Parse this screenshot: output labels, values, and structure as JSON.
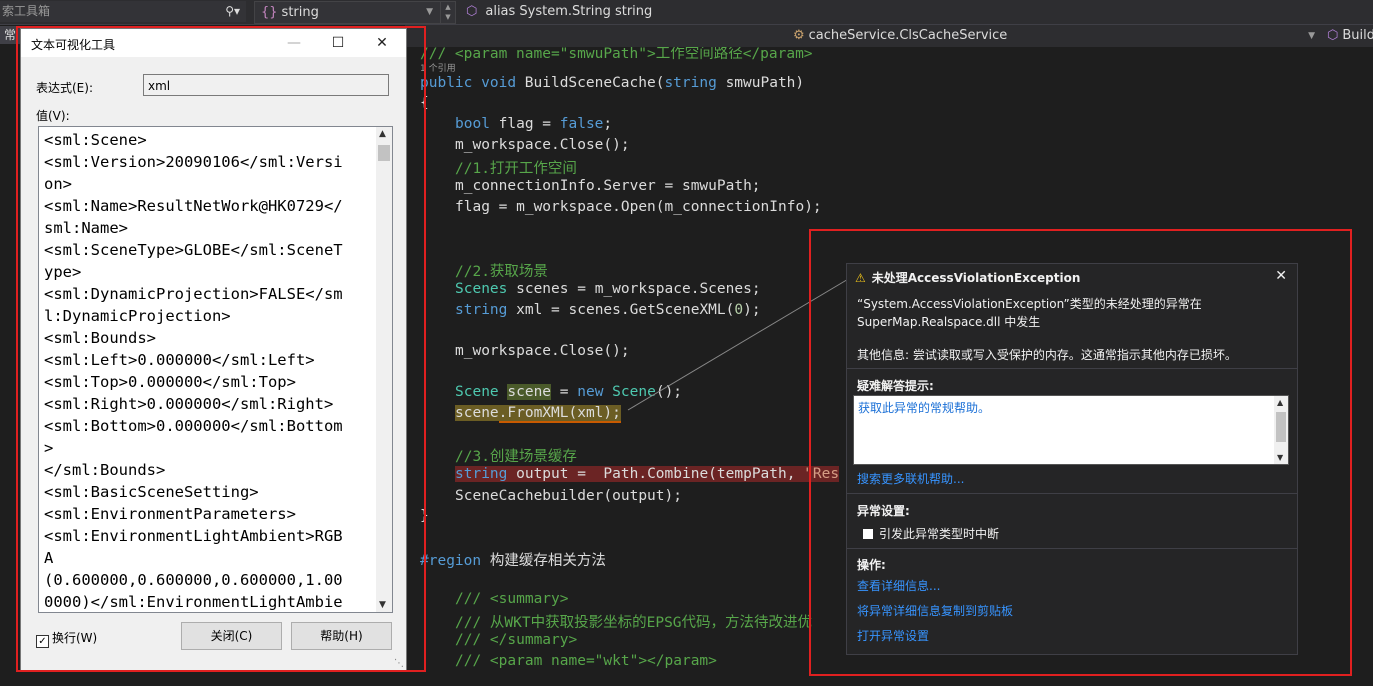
{
  "toolbar": {
    "toolbox_search": "索工具箱",
    "type_combo": "string",
    "alias_text": "alias System.String string",
    "side_tab": "常"
  },
  "navbar": {
    "class_path": "cacheService.ClsCacheService",
    "member": "Build"
  },
  "code": {
    "line_param": "/// <param name=\"smwuPath\">工作空间路径</param>",
    "ref_count": "1 个引用",
    "l_sig_kw1": "public",
    "l_sig_kw2": "void",
    "l_sig_name": " BuildSceneCache(",
    "l_sig_kw3": "string",
    "l_sig_rest": " smwuPath)",
    "brace_open": "{",
    "l_bool_kw": "bool",
    "l_bool_mid": " flag = ",
    "l_bool_false": "false",
    "l_bool_end": ";",
    "l_close1": "m_workspace.Close();",
    "c_open_ws": "//1.打开工作空间",
    "l_server": "m_connectionInfo.Server = smwuPath;",
    "l_flag": "flag = m_workspace.Open(m_connectionInfo);",
    "c_get_scene": "//2.获取场景",
    "l_scenes_type": "Scenes",
    "l_scenes_rest": " scenes = m_workspace.Scenes;",
    "l_xml_kw": "string",
    "l_xml_rest": " xml = scenes.GetSceneXML(",
    "l_xml_num": "0",
    "l_xml_end": ");",
    "l_close2": "m_workspace.Close();",
    "l_scene_type": "Scene",
    "l_scene_var": "scene",
    "l_scene_eq": " = ",
    "l_scene_new": "new",
    "l_scene_type2": " Scene",
    "l_scene_end": "();",
    "l_fromxml_var": "scene",
    "l_fromxml_call": ".FromXML(xml);",
    "c_build": "//3.创建场景缓存",
    "l_output_kw": "string",
    "l_output_rest": " output =  Path.Combine(tempPath, ",
    "l_output_str": "\"Res",
    "l_builder": "SceneCachebuilder(output);",
    "brace_close": "}",
    "region_kw": "#region",
    "region_name": " 构建缓存相关方法",
    "doc1": "/// <summary>",
    "doc2": "/// 从WKT中获取投影坐标的EPSG代码，方法待改进优",
    "doc3": "/// </summary>",
    "doc4": "/// <param name=\"wkt\"></param>"
  },
  "visualizer": {
    "title": "文本可视化工具",
    "expr_label": "表达式(E):",
    "expr_value": "xml",
    "value_label": "值(V):",
    "value_lines": [
      "<sml:Scene>",
      "<sml:Version>20090106</sml:Versi",
      "on>",
      "<sml:Name>ResultNetWork@HK0729</",
      "sml:Name>",
      "<sml:SceneType>GLOBE</sml:SceneT",
      "ype>",
      "<sml:DynamicProjection>FALSE</sm",
      "l:DynamicProjection>",
      "<sml:Bounds>",
      "<sml:Left>0.000000</sml:Left>",
      "<sml:Top>0.000000</sml:Top>",
      "<sml:Right>0.000000</sml:Right>",
      "<sml:Bottom>0.000000</sml:Bottom",
      ">",
      "</sml:Bounds>",
      "<sml:BasicSceneSetting>",
      "<sml:EnvironmentParameters>",
      "<sml:EnvironmentLightAmbient>RGB",
      "A",
      "(0.600000,0.600000,0.600000,1.00",
      "0000)</sml:EnvironmentLightAmbie"
    ],
    "wrap_label": "换行(W)",
    "wrap_checked": true,
    "close_button": "关闭(C)",
    "help_button": "帮助(H)"
  },
  "exception": {
    "title": "未处理AccessViolationException",
    "message_line1": "“System.AccessViolationException”类型的未经处理的异常在",
    "message_line2": "SuperMap.Realspace.dll 中发生",
    "extra_info": "其他信息: 尝试读取或写入受保护的内存。这通常指示其他内存已损坏。",
    "tips_heading": "疑难解答提示:",
    "tips_link": "获取此异常的常规帮助。",
    "search_link": "搜索更多联机帮助...",
    "settings_heading": "异常设置:",
    "break_label": "引发此异常类型时中断",
    "actions_heading": "操作:",
    "action_details": "查看详细信息...",
    "action_copy": "将异常详细信息复制到剪贴板",
    "action_settings": "打开异常设置"
  },
  "colors": {
    "annotation_red": "#e02020",
    "link_blue": "#3794ff",
    "keyword": "#569cd6",
    "type": "#4ec9b0",
    "comment": "#57a64a"
  },
  "icons": {
    "search": "search-icon",
    "warning": "warning-icon",
    "close": "close-icon"
  }
}
